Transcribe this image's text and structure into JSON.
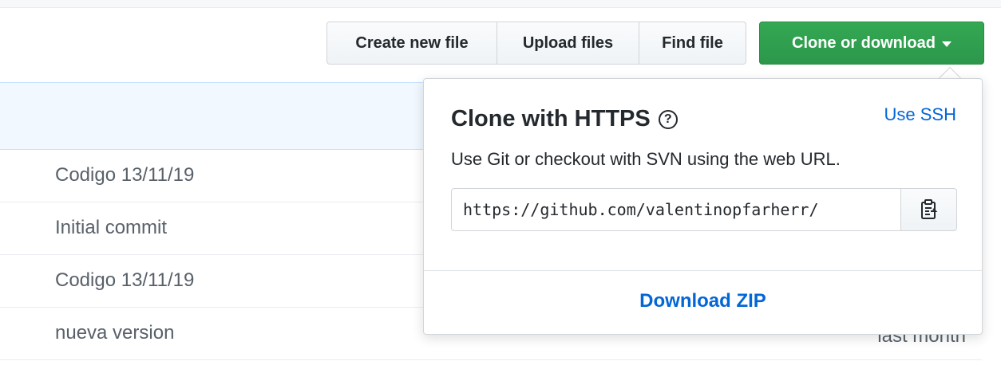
{
  "toolbar": {
    "create_new_file": "Create new file",
    "upload_files": "Upload files",
    "find_file": "Find file",
    "clone_or_download": "Clone or download"
  },
  "files": {
    "rows": [
      {
        "message": "Codigo 13/11/19",
        "age": ""
      },
      {
        "message": "Initial commit",
        "age": ""
      },
      {
        "message": "Codigo 13/11/19",
        "age": ""
      },
      {
        "message": "nueva version",
        "age": "last month"
      }
    ]
  },
  "clone_dropdown": {
    "title": "Clone with HTTPS",
    "help_icon": "question-circle-icon",
    "use_ssh": "Use SSH",
    "description": "Use Git or checkout with SVN using the web URL.",
    "url": "https://github.com/valentinopfarherr/",
    "copy_icon": "clipboard-icon",
    "download_zip": "Download ZIP"
  },
  "colors": {
    "accent_green": "#2c974b",
    "link_blue": "#0366d6",
    "header_blue": "#f1f8ff"
  }
}
